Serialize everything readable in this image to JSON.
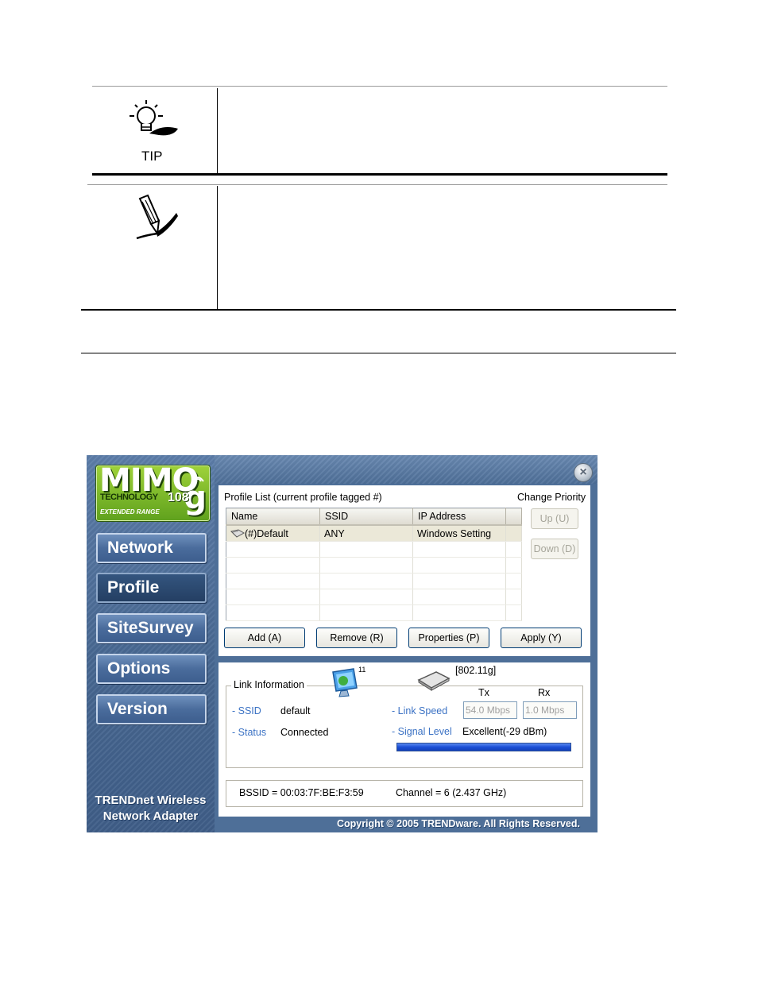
{
  "doc": {
    "tip_label": "TIP"
  },
  "app": {
    "logo": {
      "brand": "MIMO",
      "g": "g",
      "technology": "TECHNOLOGY",
      "speed": "108",
      "range": "EXTENDED RANGE"
    },
    "nav": [
      "Network",
      "Profile",
      "SiteSurvey",
      "Options",
      "Version"
    ],
    "active_nav": "Profile",
    "brand_footer": [
      "TRENDnet Wireless",
      "Network Adapter"
    ],
    "copyright": "Copyright © 2005 TRENDware. All Rights Reserved.",
    "profile": {
      "list_title": "Profile List (current profile tagged #)",
      "change_priority": "Change Priority",
      "columns": [
        "Name",
        "SSID",
        "IP Address"
      ],
      "rows": [
        {
          "name": "(#)Default",
          "ssid": "ANY",
          "ip": "Windows Setting"
        }
      ],
      "up_label": "Up (U)",
      "down_label": "Down (D)",
      "buttons": {
        "add": "Add (A)",
        "remove": "Remove (R)",
        "properties": "Properties (P)",
        "apply": "Apply (Y)"
      }
    },
    "link": {
      "group_title": "Link Information",
      "channel_badge": "11",
      "mode": "[802.11g]",
      "tx_label": "Tx",
      "rx_label": "Rx",
      "ssid_label": "- SSID",
      "ssid_value": "default",
      "status_label": "- Status",
      "status_value": "Connected",
      "link_speed_label": "- Link Speed",
      "tx_speed": "54.0 Mbps",
      "rx_speed": "1.0 Mbps",
      "signal_label": "- Signal Level",
      "signal_value": "Excellent(-29 dBm)",
      "signal_level": 1.0,
      "bssid": "BSSID = 00:03:7F:BE:F3:59",
      "channel": "Channel = 6 (2.437 GHz)"
    }
  }
}
